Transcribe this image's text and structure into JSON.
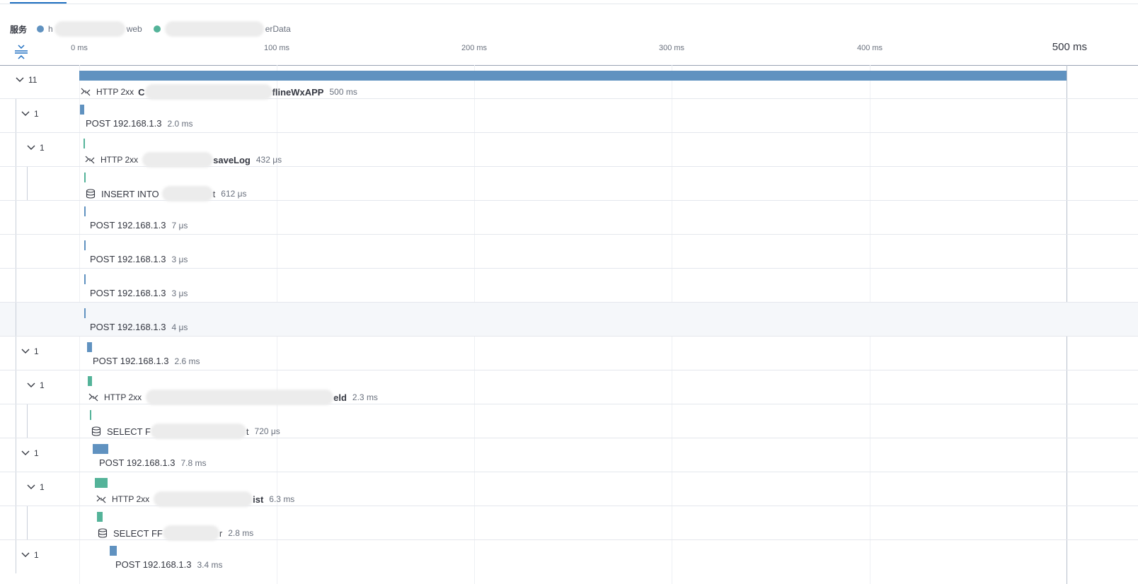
{
  "legend": {
    "title": "服务",
    "services": [
      {
        "text_left": "h",
        "text_right": "web",
        "color": "#6092c0"
      },
      {
        "text_left": "",
        "text_right": "erData",
        "color": "#54b399"
      }
    ]
  },
  "axis": {
    "ticks": [
      "0 ms",
      "100 ms",
      "200 ms",
      "300 ms",
      "400 ms"
    ],
    "end_label": "500 ms"
  },
  "colors": {
    "service_a": "#6092c0",
    "service_b": "#54b399"
  },
  "rows": [
    {
      "count": "11",
      "pre": "HTTP 2xx",
      "name_left": "C",
      "name_right": "flineWxAPP",
      "duration": "500 ms"
    },
    {
      "count": "1",
      "pre": "",
      "name_left": "POST 192.168.1.3",
      "name_right": "",
      "duration": "2.0 ms"
    },
    {
      "count": "1",
      "pre": "HTTP 2xx",
      "name_left": "",
      "name_right": "saveLog",
      "duration": "432 μs"
    },
    {
      "count": "",
      "pre": "",
      "name_left": "INSERT INTO",
      "name_right": "t",
      "duration": "612 μs"
    },
    {
      "count": "",
      "pre": "",
      "name_left": "POST 192.168.1.3",
      "name_right": "",
      "duration": "7 μs"
    },
    {
      "count": "",
      "pre": "",
      "name_left": "POST 192.168.1.3",
      "name_right": "",
      "duration": "3 μs"
    },
    {
      "count": "",
      "pre": "",
      "name_left": "POST 192.168.1.3",
      "name_right": "",
      "duration": "3 μs"
    },
    {
      "count": "",
      "pre": "",
      "name_left": "POST 192.168.1.3",
      "name_right": "",
      "duration": "4 μs"
    },
    {
      "count": "1",
      "pre": "",
      "name_left": "POST 192.168.1.3",
      "name_right": "",
      "duration": "2.6 ms"
    },
    {
      "count": "1",
      "pre": "HTTP 2xx",
      "name_left": "",
      "name_right": "eld",
      "duration": "2.3 ms"
    },
    {
      "count": "",
      "pre": "",
      "name_left": "SELECT F",
      "name_right": "t",
      "duration": "720 μs"
    },
    {
      "count": "1",
      "pre": "",
      "name_left": "POST 192.168.1.3",
      "name_right": "",
      "duration": "7.8 ms"
    },
    {
      "count": "1",
      "pre": "HTTP 2xx",
      "name_left": "",
      "name_right": "ist",
      "duration": "6.3 ms"
    },
    {
      "count": "",
      "pre": "",
      "name_left": "SELECT FF",
      "name_right": "r",
      "duration": "2.8 ms"
    },
    {
      "count": "1",
      "pre": "",
      "name_left": "POST 192.168.1.3",
      "name_right": "",
      "duration": "3.4 ms"
    }
  ]
}
